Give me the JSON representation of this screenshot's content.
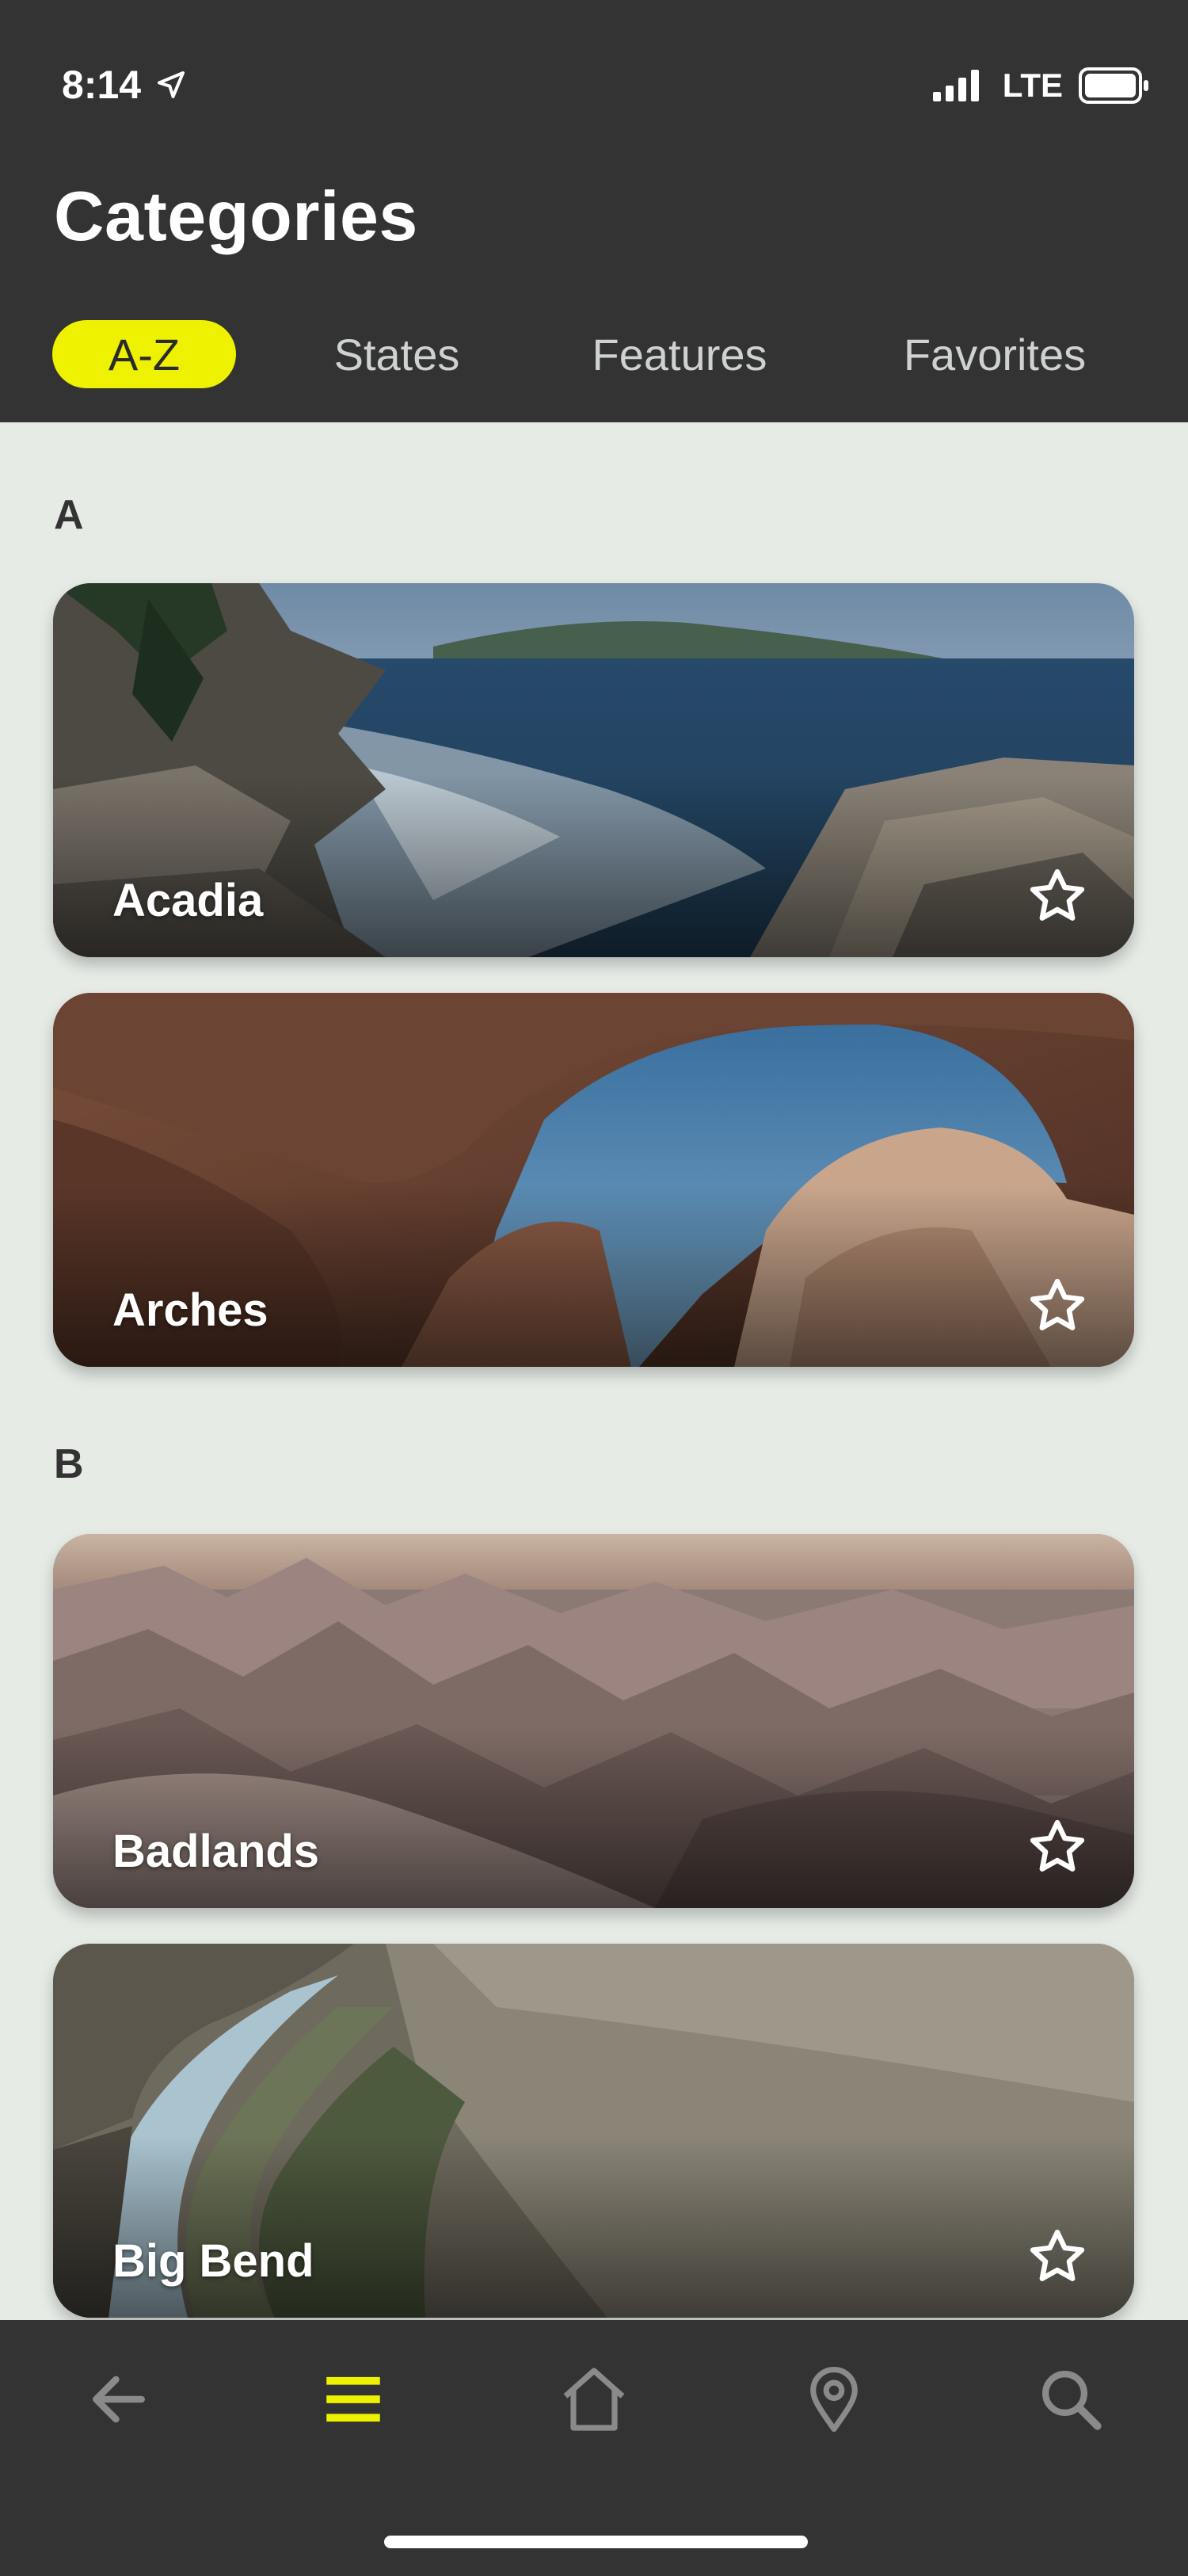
{
  "status_bar": {
    "time": "8:14",
    "network": "LTE"
  },
  "header": {
    "title": "Categories"
  },
  "tabs": [
    {
      "label": "A-Z",
      "active": true
    },
    {
      "label": "States",
      "active": false
    },
    {
      "label": "Features",
      "active": false
    },
    {
      "label": "Favorites",
      "active": false
    }
  ],
  "sections": [
    {
      "letter": "A",
      "parks": [
        {
          "name": "Acadia"
        },
        {
          "name": "Arches"
        }
      ]
    },
    {
      "letter": "B",
      "parks": [
        {
          "name": "Badlands"
        },
        {
          "name": "Big Bend"
        }
      ]
    }
  ],
  "bottom_nav": {
    "items": [
      {
        "icon": "back-arrow-icon",
        "active": false
      },
      {
        "icon": "menu-icon",
        "active": true
      },
      {
        "icon": "home-icon",
        "active": false
      },
      {
        "icon": "location-pin-icon",
        "active": false
      },
      {
        "icon": "search-icon",
        "active": false
      }
    ]
  },
  "colors": {
    "accent": "#eef200",
    "header_bg": "#333333",
    "content_bg": "#e6ebe6",
    "inactive_icon": "#8a8a8a"
  }
}
